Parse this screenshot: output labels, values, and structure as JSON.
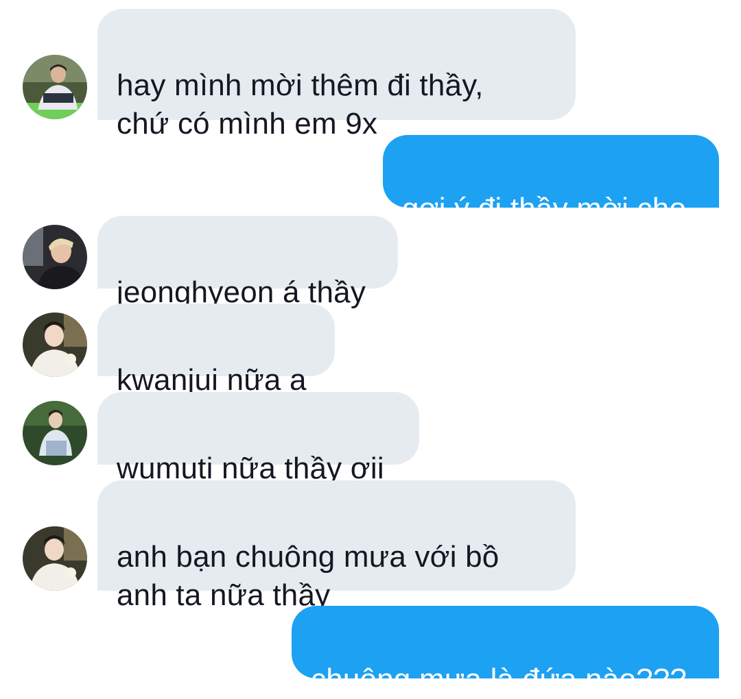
{
  "conversation": {
    "messages": [
      {
        "direction": "incoming",
        "text": "hay mình mời thêm đi thầy,\nchứ có mình em 9x",
        "avatar": "avatar-photo-1"
      },
      {
        "direction": "outgoing",
        "text": "gợi ý đi thầy mời cho"
      },
      {
        "direction": "incoming",
        "text": "jeonghyeon á thầy",
        "avatar": "avatar-photo-2"
      },
      {
        "direction": "incoming",
        "text": "kwanjui nữa ạ",
        "avatar": "avatar-photo-3"
      },
      {
        "direction": "incoming",
        "text": "wumuti nữa thầy ơii",
        "avatar": "avatar-photo-4"
      },
      {
        "direction": "incoming",
        "text": "anh bạn chuông mưa với bồ\nanh ta nữa thầy",
        "avatar": "avatar-photo-5"
      },
      {
        "direction": "outgoing",
        "text": "chuông mưa là đứa nào???"
      }
    ]
  },
  "colors": {
    "incoming_bubble": "#e6ebf0",
    "outgoing_bubble": "#1da1f2",
    "incoming_text": "#141823",
    "outgoing_text": "#ffffff"
  }
}
